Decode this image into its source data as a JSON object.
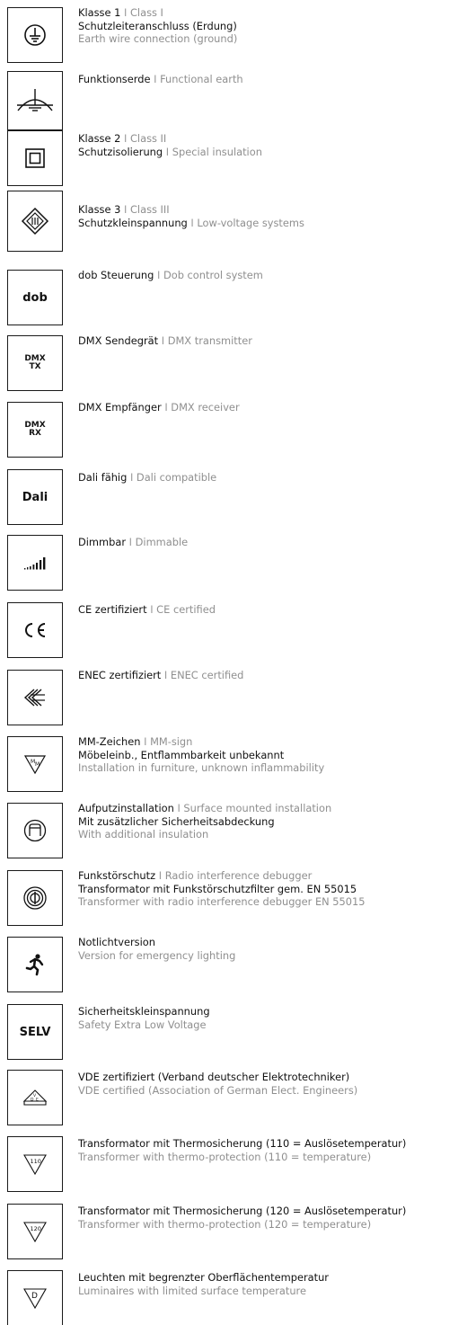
{
  "separator": "I",
  "items": [
    {
      "icon": "protective-earth-icon",
      "title_de": "Klasse 1",
      "title_en": "Class I",
      "line2_de": "Schutzleiteranschluss (Erdung)",
      "line3": "Earth wire connection (ground)"
    },
    {
      "icon": "functional-earth-icon",
      "title_de": "Funktionserde",
      "title_en": "Functional earth"
    },
    {
      "icon": "double-square-icon",
      "title_de": "Klasse 2",
      "title_en": "Class II",
      "line2_de": "Schutzisolierung",
      "line2_en": "Special insulation"
    },
    {
      "icon": "class-three-diamond-icon",
      "title_de": "Klasse 3",
      "title_en": "Class III",
      "line2_de": "Schutzkleinspannung",
      "line2_en": "Low-voltage systems"
    },
    {
      "icon": "dob-label",
      "box_text": "dob",
      "title_de": "dob Steuerung",
      "title_en": "Dob control system"
    },
    {
      "icon": "dmx-tx-label",
      "box_text1": "DMX",
      "box_text2": "TX",
      "title_de": "DMX Sendegrät",
      "title_en": "DMX transmitter"
    },
    {
      "icon": "dmx-rx-label",
      "box_text1": "DMX",
      "box_text2": "RX",
      "title_de": "DMX Empfänger",
      "title_en": "DMX receiver"
    },
    {
      "icon": "dali-label",
      "box_text": "Dali",
      "title_de": "Dali fähig",
      "title_en": "Dali compatible"
    },
    {
      "icon": "dimmable-bars-icon",
      "title_de": "Dimmbar",
      "title_en": "Dimmable"
    },
    {
      "icon": "ce-mark-icon",
      "title_de": "CE zertifiziert",
      "title_en": "CE certified"
    },
    {
      "icon": "enec-mark-icon",
      "title_de": "ENEC zertifiziert",
      "title_en": "ENEC certified"
    },
    {
      "icon": "mm-sign-icon",
      "title_de": "MM-Zeichen",
      "title_en": "MM-sign",
      "line2_de": "Möbeleinb., Entflammbarkeit unbekannt",
      "line3": "Installation in furniture, unknown inflammability"
    },
    {
      "icon": "surface-mount-icon",
      "title_de": "Aufputzinstallation",
      "title_en": "Surface mounted installation",
      "line2_de": "Mit zusätzlicher Sicherheitsabdeckung",
      "line3": "With additional insulation"
    },
    {
      "icon": "radio-interference-icon",
      "title_de": "Funkstörschutz",
      "title_en": "Radio interference debugger",
      "line2_de": "Transformator mit Funkstörschutzfilter gem. EN 55015",
      "line3": "Transformer with radio interference debugger EN 55015"
    },
    {
      "icon": "emergency-running-man-icon",
      "title_de": "Notlichtversion",
      "line3": "Version for emergency lighting"
    },
    {
      "icon": "selv-label",
      "box_text": "SELV",
      "title_de": "Sicherheitskleinspannung",
      "line3": "Safety Extra Low Voltage"
    },
    {
      "icon": "vde-mark-icon",
      "title_de": "VDE zertifiziert (Verband deutscher Elektrotechniker)",
      "line3": "VDE certified (Association of German Elect. Engineers)"
    },
    {
      "icon": "thermo-110-icon",
      "box_text": "110",
      "title_de": "Transformator mit Thermosicherung (110 = Auslösetemperatur)",
      "line3": "Transformer with thermo-protection (110 = temperature)"
    },
    {
      "icon": "thermo-120-icon",
      "box_text": "120",
      "title_de": "Transformator mit Thermosicherung (120 = Auslösetemperatur)",
      "line3": "Transformer with thermo-protection (120 = temperature)"
    },
    {
      "icon": "limited-surface-temp-icon",
      "box_text": "D",
      "title_de": "Leuchten mit begrenzter Oberflächentemperatur",
      "line3": "Luminaires with limited surface temperature"
    }
  ]
}
